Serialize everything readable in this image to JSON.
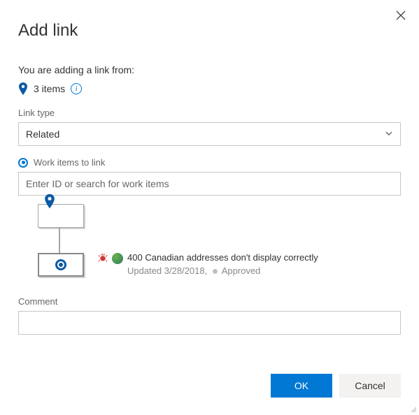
{
  "dialog": {
    "title": "Add link",
    "intro": "You are adding a link from:",
    "items_count_text": "3 items"
  },
  "link_type": {
    "label": "Link type",
    "selected": "Related"
  },
  "work_items": {
    "label": "Work items to link",
    "placeholder": "Enter ID or search for work items",
    "selected": {
      "id": "400",
      "title": "Canadian addresses don't display correctly",
      "updated_prefix": "Updated",
      "updated_date": "3/28/2018,",
      "state": "Approved"
    }
  },
  "comment": {
    "label": "Comment",
    "value": ""
  },
  "buttons": {
    "ok": "OK",
    "cancel": "Cancel"
  }
}
